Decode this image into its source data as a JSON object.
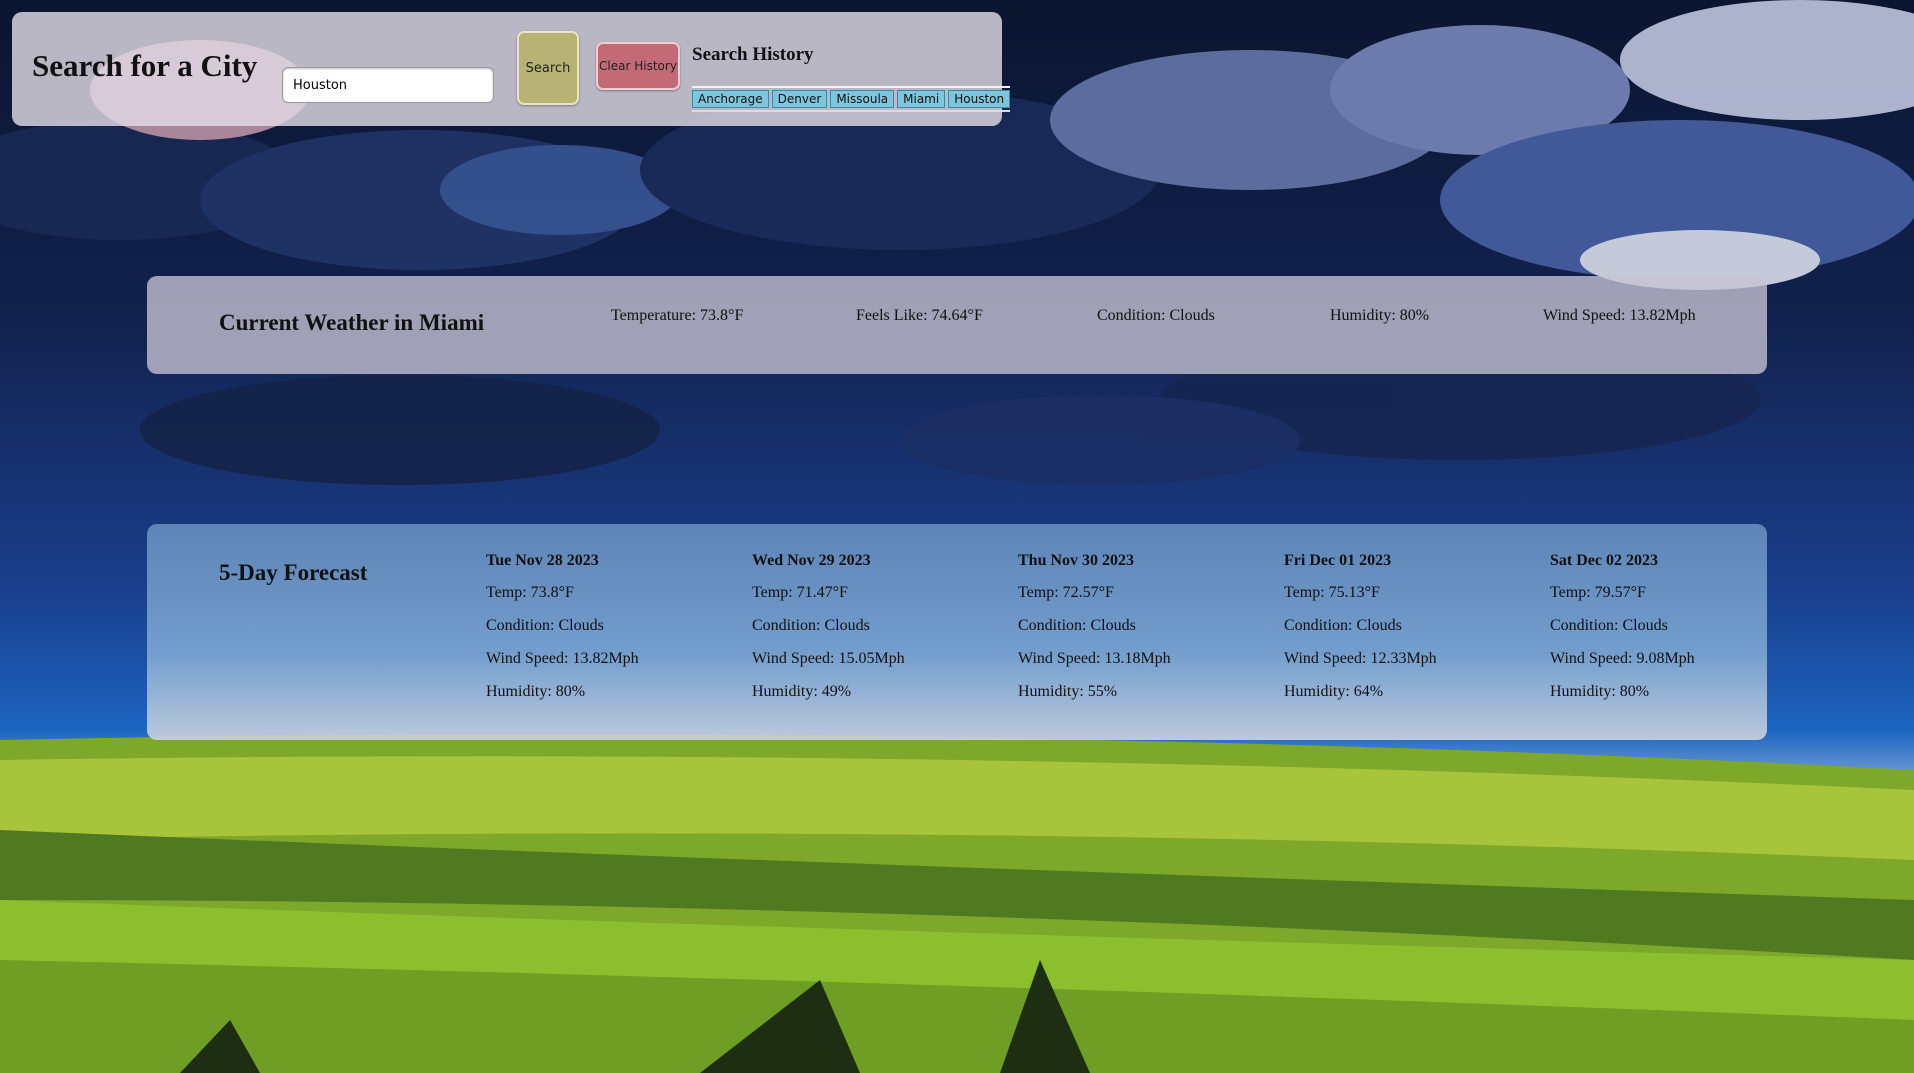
{
  "search": {
    "title": "Search for a City",
    "input_value": "Houston",
    "search_label": "Search",
    "clear_label": "Clear History",
    "history_title": "Search History",
    "history": [
      "Anchorage",
      "Denver",
      "Missoula",
      "Miami",
      "Houston"
    ]
  },
  "current": {
    "title": "Current Weather in Miami",
    "temperature": "Temperature: 73.8°F",
    "feels_like": "Feels Like: 74.64°F",
    "condition": "Condition: Clouds",
    "humidity": "Humidity: 80%",
    "wind": "Wind Speed: 13.82Mph"
  },
  "forecast": {
    "title": "5-Day Forecast",
    "days": [
      {
        "date": "Tue Nov 28 2023",
        "temp": "Temp: 73.8°F",
        "condition": "Condition: Clouds",
        "wind": "Wind Speed: 13.82Mph",
        "humidity": "Humidity: 80%"
      },
      {
        "date": "Wed Nov 29 2023",
        "temp": "Temp: 71.47°F",
        "condition": "Condition: Clouds",
        "wind": "Wind Speed: 15.05Mph",
        "humidity": "Humidity: 49%"
      },
      {
        "date": "Thu Nov 30 2023",
        "temp": "Temp: 72.57°F",
        "condition": "Condition: Clouds",
        "wind": "Wind Speed: 13.18Mph",
        "humidity": "Humidity: 55%"
      },
      {
        "date": "Fri Dec 01 2023",
        "temp": "Temp: 75.13°F",
        "condition": "Condition: Clouds",
        "wind": "Wind Speed: 12.33Mph",
        "humidity": "Humidity: 64%"
      },
      {
        "date": "Sat Dec 02 2023",
        "temp": "Temp: 79.57°F",
        "condition": "Condition: Clouds",
        "wind": "Wind Speed: 9.08Mph",
        "humidity": "Humidity: 80%"
      }
    ]
  },
  "colors": {
    "search_button": "#b8b274",
    "clear_button": "#c26b76",
    "history_item": "#7ec6dc",
    "sky_top": "#0d1a3a",
    "sky_bottom": "#1e6ec4",
    "field": "#8fbf2f"
  }
}
